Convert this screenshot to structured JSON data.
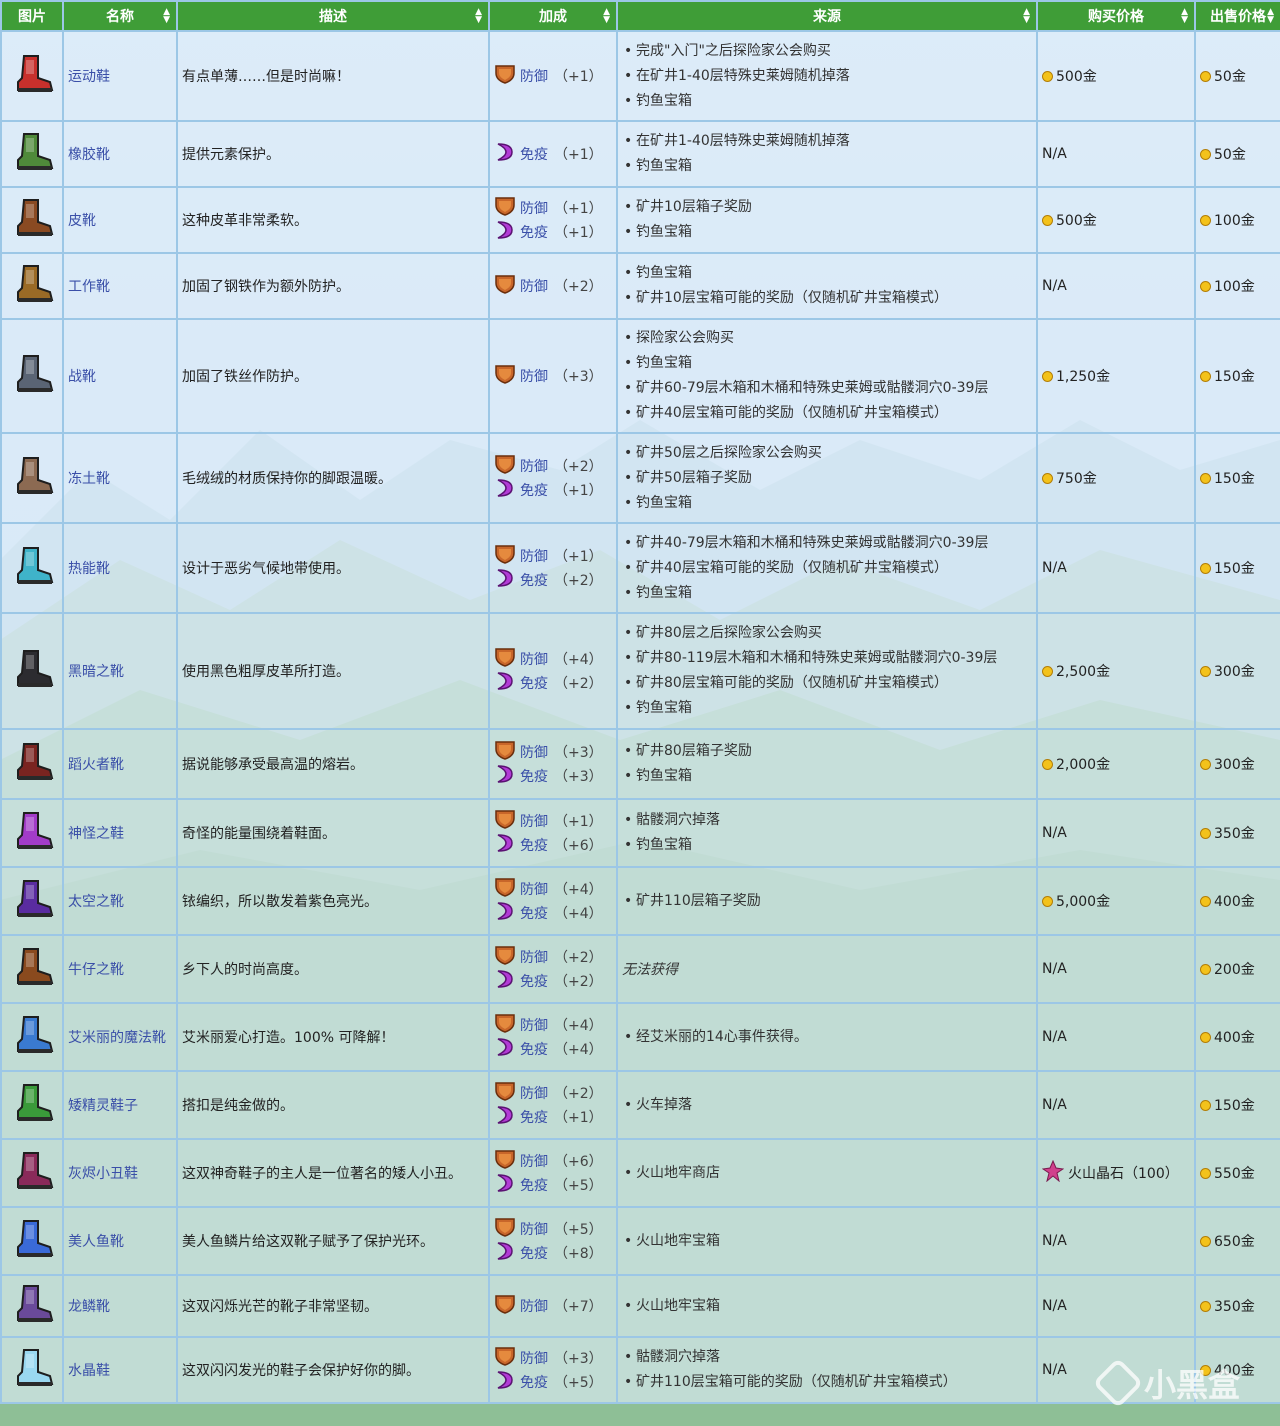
{
  "header": {
    "image": "图片",
    "name": "名称",
    "description": "描述",
    "bonus": "加成",
    "source": "来源",
    "buy_price": "购买价格",
    "sell_price": "出售价格"
  },
  "colors": {
    "header_bg": "#3f9d37",
    "link": "#3a4fa8",
    "coin": "#f3c21b",
    "defense": "#c8662a",
    "immunity": "#b23bd6"
  },
  "rows": [
    {
      "icon": "red-sneaker-icon",
      "boot_color": "#c8302c",
      "name": "运动鞋",
      "desc": "有点单薄……但是时尚嘛！",
      "stats": [
        {
          "type": "defense",
          "label": "防御",
          "value": "（+1）"
        }
      ],
      "source": [
        "完成\"入门\"之后探险家公会购买",
        "在矿井1-40层特殊史莱姆随机掉落",
        "钓鱼宝箱"
      ],
      "buy": "500金",
      "buy_type": "coin",
      "sell": "50金"
    },
    {
      "icon": "rubber-boot-icon",
      "boot_color": "#4f8a3a",
      "name": "橡胶靴",
      "desc": "提供元素保护。",
      "stats": [
        {
          "type": "immunity",
          "label": "免疫",
          "value": "（+1）"
        }
      ],
      "source": [
        "在矿井1-40层特殊史莱姆随机掉落",
        "钓鱼宝箱"
      ],
      "buy": "N/A",
      "buy_type": "text",
      "sell": "50金"
    },
    {
      "icon": "leather-boot-icon",
      "boot_color": "#8a4a22",
      "name": "皮靴",
      "desc": "这种皮革非常柔软。",
      "stats": [
        {
          "type": "defense",
          "label": "防御",
          "value": "（+1）"
        },
        {
          "type": "immunity",
          "label": "免疫",
          "value": "（+1）"
        }
      ],
      "source": [
        "矿井10层箱子奖励",
        "钓鱼宝箱"
      ],
      "buy": "500金",
      "buy_type": "coin",
      "sell": "100金"
    },
    {
      "icon": "work-boot-icon",
      "boot_color": "#9a6a26",
      "name": "工作靴",
      "desc": "加固了钢铁作为额外防护。",
      "stats": [
        {
          "type": "defense",
          "label": "防御",
          "value": "（+2）"
        }
      ],
      "source": [
        "钓鱼宝箱",
        "矿井10层宝箱可能的奖励（仅随机矿井宝箱模式）"
      ],
      "buy": "N/A",
      "buy_type": "text",
      "sell": "100金"
    },
    {
      "icon": "combat-boot-icon",
      "boot_color": "#5a6474",
      "name": "战靴",
      "desc": "加固了铁丝作防护。",
      "stats": [
        {
          "type": "defense",
          "label": "防御",
          "value": "（+3）"
        }
      ],
      "source": [
        "探险家公会购买",
        "钓鱼宝箱",
        "矿井60-79层木箱和木桶和特殊史莱姆或骷髅洞穴0-39层",
        "矿井40层宝箱可能的奖励（仅随机矿井宝箱模式）"
      ],
      "buy": "1,250金",
      "buy_type": "coin",
      "sell": "150金"
    },
    {
      "icon": "tundra-boot-icon",
      "boot_color": "#8c6a52",
      "name": "冻土靴",
      "desc": "毛绒绒的材质保持你的脚跟温暖。",
      "stats": [
        {
          "type": "defense",
          "label": "防御",
          "value": "（+2）"
        },
        {
          "type": "immunity",
          "label": "免疫",
          "value": "（+1）"
        }
      ],
      "source": [
        "矿井50层之后探险家公会购买",
        "矿井50层箱子奖励",
        "钓鱼宝箱"
      ],
      "buy": "750金",
      "buy_type": "coin",
      "sell": "150金"
    },
    {
      "icon": "thermal-boot-icon",
      "boot_color": "#3fb3c9",
      "name": "热能靴",
      "desc": "设计于恶劣气候地带使用。",
      "stats": [
        {
          "type": "defense",
          "label": "防御",
          "value": "（+1）"
        },
        {
          "type": "immunity",
          "label": "免疫",
          "value": "（+2）"
        }
      ],
      "source": [
        "矿井40-79层木箱和木桶和特殊史莱姆或骷髅洞穴0-39层",
        "矿井40层宝箱可能的奖励（仅随机矿井宝箱模式）",
        "钓鱼宝箱"
      ],
      "buy": "N/A",
      "buy_type": "text",
      "sell": "150金"
    },
    {
      "icon": "dark-boot-icon",
      "boot_color": "#2c2c30",
      "name": "黑暗之靴",
      "desc": "使用黑色粗厚皮革所打造。",
      "stats": [
        {
          "type": "defense",
          "label": "防御",
          "value": "（+4）"
        },
        {
          "type": "immunity",
          "label": "免疫",
          "value": "（+2）"
        }
      ],
      "source": [
        "矿井80层之后探险家公会购买",
        "矿井80-119层木箱和木桶和特殊史莱姆或骷髅洞穴0-39层",
        "矿井80层宝箱可能的奖励（仅随机矿井宝箱模式）",
        "钓鱼宝箱"
      ],
      "buy": "2,500金",
      "buy_type": "coin",
      "sell": "300金"
    },
    {
      "icon": "firewalker-boot-icon",
      "boot_color": "#7a2420",
      "name": "蹈火者靴",
      "desc": "据说能够承受最高温的熔岩。",
      "stats": [
        {
          "type": "defense",
          "label": "防御",
          "value": "（+3）"
        },
        {
          "type": "immunity",
          "label": "免疫",
          "value": "（+3）"
        }
      ],
      "source": [
        "矿井80层箱子奖励",
        "钓鱼宝箱"
      ],
      "buy": "2,000金",
      "buy_type": "coin",
      "sell": "300金"
    },
    {
      "icon": "genie-shoe-icon",
      "boot_color": "#a23cc8",
      "name": "神怪之鞋",
      "desc": "奇怪的能量围绕着鞋面。",
      "stats": [
        {
          "type": "defense",
          "label": "防御",
          "value": "（+1）"
        },
        {
          "type": "immunity",
          "label": "免疫",
          "value": "（+6）"
        }
      ],
      "source": [
        "骷髅洞穴掉落",
        "钓鱼宝箱"
      ],
      "buy": "N/A",
      "buy_type": "text",
      "sell": "350金"
    },
    {
      "icon": "space-boot-icon",
      "boot_color": "#5a2ca0",
      "name": "太空之靴",
      "desc": "铱编织，所以散发着紫色亮光。",
      "stats": [
        {
          "type": "defense",
          "label": "防御",
          "value": "（+4）"
        },
        {
          "type": "immunity",
          "label": "免疫",
          "value": "（+4）"
        }
      ],
      "source": [
        "矿井110层箱子奖励"
      ],
      "buy": "5,000金",
      "buy_type": "coin",
      "sell": "400金"
    },
    {
      "icon": "cowboy-boot-icon",
      "boot_color": "#8a4a1e",
      "name": "牛仔之靴",
      "desc": "乡下人的时尚高度。",
      "stats": [
        {
          "type": "defense",
          "label": "防御",
          "value": "（+2）"
        },
        {
          "type": "immunity",
          "label": "免疫",
          "value": "（+2）"
        }
      ],
      "source_note": "无法获得",
      "buy": "N/A",
      "buy_type": "text",
      "sell": "200金"
    },
    {
      "icon": "emily-boot-icon",
      "boot_color": "#3a7ad0",
      "name": "艾米丽的魔法靴",
      "desc": "艾米丽爱心打造。100% 可降解！",
      "stats": [
        {
          "type": "defense",
          "label": "防御",
          "value": "（+4）"
        },
        {
          "type": "immunity",
          "label": "免疫",
          "value": "（+4）"
        }
      ],
      "source": [
        "经艾米丽的14心事件获得。"
      ],
      "buy": "N/A",
      "buy_type": "text",
      "sell": "400金"
    },
    {
      "icon": "leprechaun-shoe-icon",
      "boot_color": "#3a9a3a",
      "name": "矮精灵鞋子",
      "desc": "搭扣是纯金做的。",
      "stats": [
        {
          "type": "defense",
          "label": "防御",
          "value": "（+2）"
        },
        {
          "type": "immunity",
          "label": "免疫",
          "value": "（+1）"
        }
      ],
      "source": [
        "火车掉落"
      ],
      "buy": "N/A",
      "buy_type": "text",
      "sell": "150金"
    },
    {
      "icon": "cinderclown-shoe-icon",
      "boot_color": "#8a2a5a",
      "name": "灰烬小丑鞋",
      "desc": "这双神奇鞋子的主人是一位著名的矮人小丑。",
      "stats": [
        {
          "type": "defense",
          "label": "防御",
          "value": "（+6）"
        },
        {
          "type": "immunity",
          "label": "免疫",
          "value": "（+5）"
        }
      ],
      "source": [
        "火山地牢商店"
      ],
      "buy": "火山晶石（100）",
      "buy_type": "gem",
      "sell": "550金"
    },
    {
      "icon": "mermaid-boot-icon",
      "boot_color": "#3a6ad8",
      "name": "美人鱼靴",
      "desc": "美人鱼鳞片给这双靴子赋予了保护光环。",
      "stats": [
        {
          "type": "defense",
          "label": "防御",
          "value": "（+5）"
        },
        {
          "type": "immunity",
          "label": "免疫",
          "value": "（+8）"
        }
      ],
      "source": [
        "火山地牢宝箱"
      ],
      "buy": "N/A",
      "buy_type": "text",
      "sell": "650金"
    },
    {
      "icon": "dragonscale-boot-icon",
      "boot_color": "#6a4a9a",
      "name": "龙鳞靴",
      "desc": "这双闪烁光芒的靴子非常坚韧。",
      "stats": [
        {
          "type": "defense",
          "label": "防御",
          "value": "（+7）"
        }
      ],
      "source": [
        "火山地牢宝箱"
      ],
      "buy": "N/A",
      "buy_type": "text",
      "sell": "350金"
    },
    {
      "icon": "crystal-shoe-icon",
      "boot_color": "#9ad8f0",
      "name": "水晶鞋",
      "desc": "这双闪闪发光的鞋子会保护好你的脚。",
      "stats": [
        {
          "type": "defense",
          "label": "防御",
          "value": "（+3）"
        },
        {
          "type": "immunity",
          "label": "免疫",
          "value": "（+5）"
        }
      ],
      "source": [
        "骷髅洞穴掉落",
        "矿井110层宝箱可能的奖励（仅随机矿井宝箱模式）"
      ],
      "buy": "N/A",
      "buy_type": "text",
      "sell": "400金"
    }
  ],
  "watermark": "小黑盒"
}
